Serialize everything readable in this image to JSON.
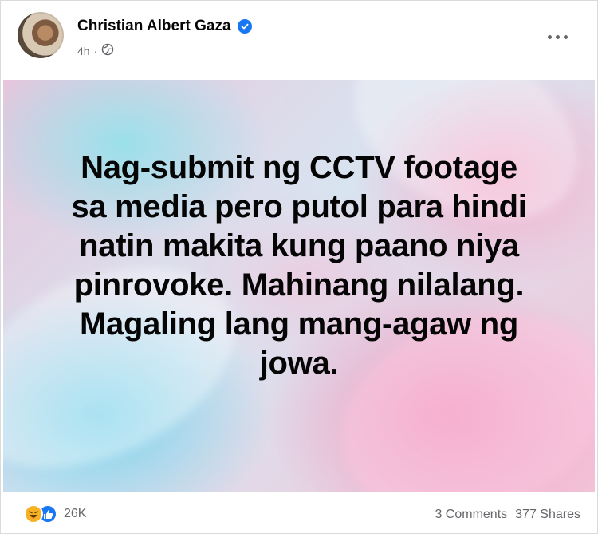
{
  "post": {
    "author": "Christian Albert Gaza",
    "time": "4h",
    "privacy_icon": "globe-icon",
    "verified_icon": "verified-badge-icon",
    "menu_icon": "more-options-icon",
    "text": "Nag-submit ng CCTV footage\nsa media pero putol para hindi\nnatin makita kung paano niya\npinrovoke. Mahinang nilalang.\nMagaling lang mang-agaw ng\njowa."
  },
  "footer": {
    "reactions": [
      "haha-icon",
      "like-icon"
    ],
    "reaction_count": "26K",
    "comments": "3 Comments",
    "shares": "377 Shares"
  },
  "colors": {
    "accent": "#1877f2",
    "haha": "#f7b125",
    "text": "#050505",
    "secondary_text": "#65676b"
  }
}
